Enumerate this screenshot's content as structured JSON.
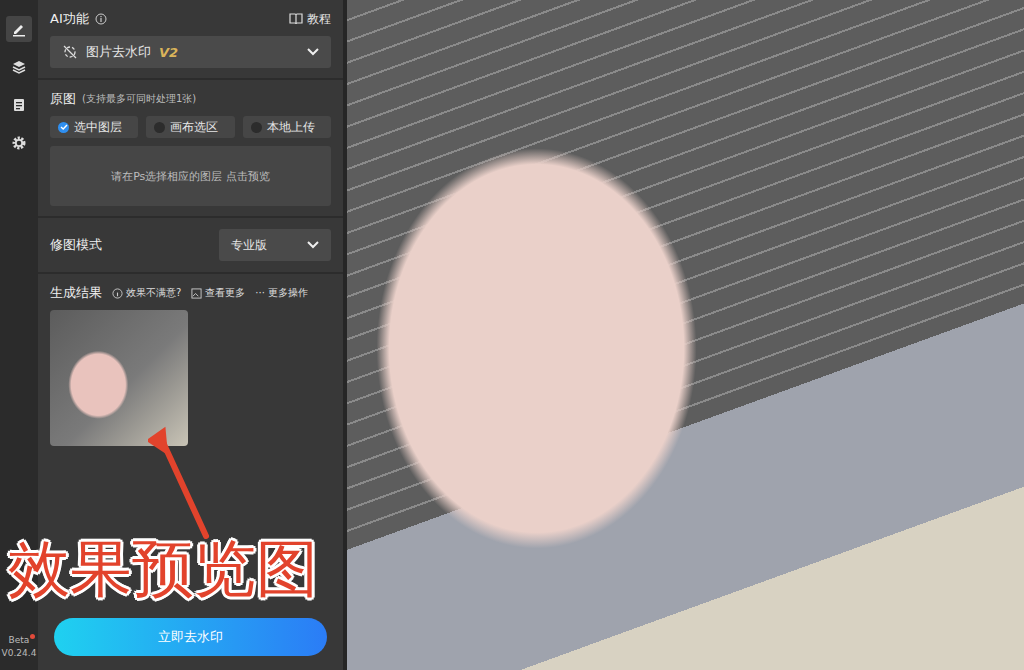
{
  "rail": {
    "items": [
      {
        "selected": true
      },
      {
        "selected": false
      },
      {
        "selected": false
      },
      {
        "selected": false
      }
    ]
  },
  "header": {
    "title": "AI功能",
    "tutorial": "教程"
  },
  "feature": {
    "name": "图片去水印",
    "version": "V2"
  },
  "source": {
    "label": "原图",
    "hint": "(支持最多可同时处理1张)",
    "options": [
      {
        "label": "选中图层",
        "selected": true
      },
      {
        "label": "画布选区",
        "selected": false
      },
      {
        "label": "本地上传",
        "selected": false
      }
    ],
    "placeholder": "请在Ps选择相应的图层 点击预览"
  },
  "mode": {
    "label": "修图模式",
    "value": "专业版"
  },
  "results": {
    "label": "生成结果",
    "feedback": "效果不满意?",
    "more": "查看更多",
    "actions_glyph": "···",
    "actions": "更多操作"
  },
  "annotation": {
    "text": "效果预览图"
  },
  "primary_button": "立即去水印",
  "footer": {
    "badge": "Beta",
    "version": "V0.24.4"
  }
}
